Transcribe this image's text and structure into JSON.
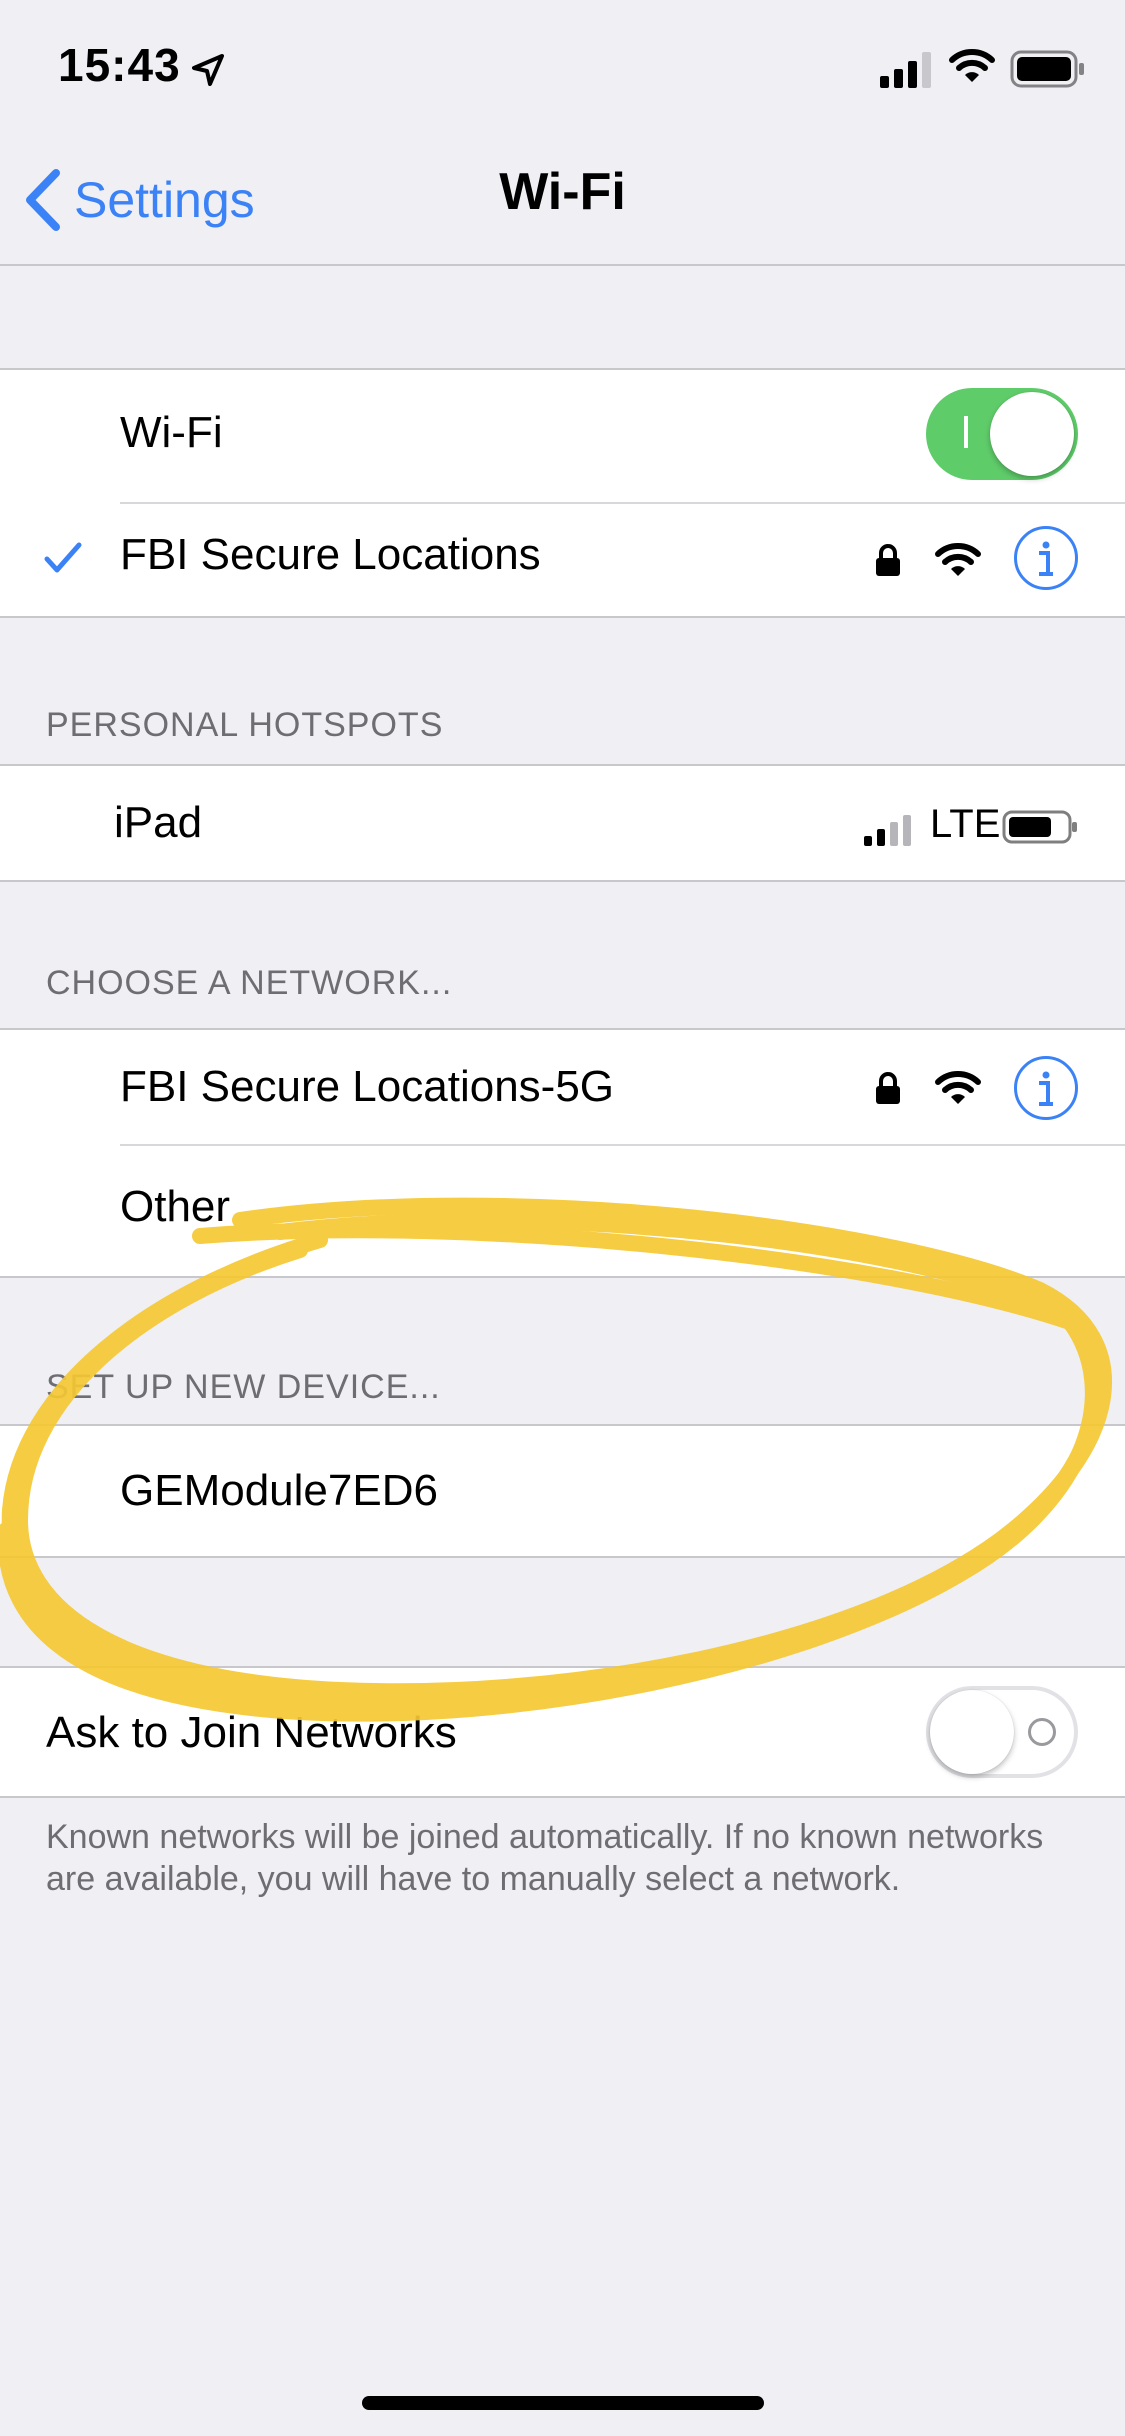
{
  "status_bar": {
    "time": "15:43"
  },
  "nav": {
    "back_label": "Settings",
    "title": "Wi-Fi"
  },
  "wifi_section": {
    "wifi_label": "Wi-Fi",
    "wifi_enabled": true,
    "connected_network": "FBI Secure Locations"
  },
  "personal_hotspots": {
    "header": "PERSONAL HOTSPOTS",
    "items": [
      {
        "name": "iPad",
        "network_type": "LTE"
      }
    ]
  },
  "choose_network": {
    "header": "CHOOSE A NETWORK...",
    "items": [
      {
        "name": "FBI Secure Locations-5G",
        "secured": true
      },
      {
        "name": "Other"
      }
    ]
  },
  "setup_device": {
    "header": "SET UP NEW DEVICE...",
    "items": [
      {
        "name": "GEModule7ED6"
      }
    ]
  },
  "ask_to_join": {
    "label": "Ask to Join Networks",
    "enabled": false,
    "footer": "Known networks will be joined automatically. If no known networks are available, you will have to manually select a network."
  },
  "colors": {
    "accent": "#3b82f6",
    "toggle_on": "#5fcc6a",
    "highlight": "#f5c833",
    "background": "#efeff4"
  }
}
